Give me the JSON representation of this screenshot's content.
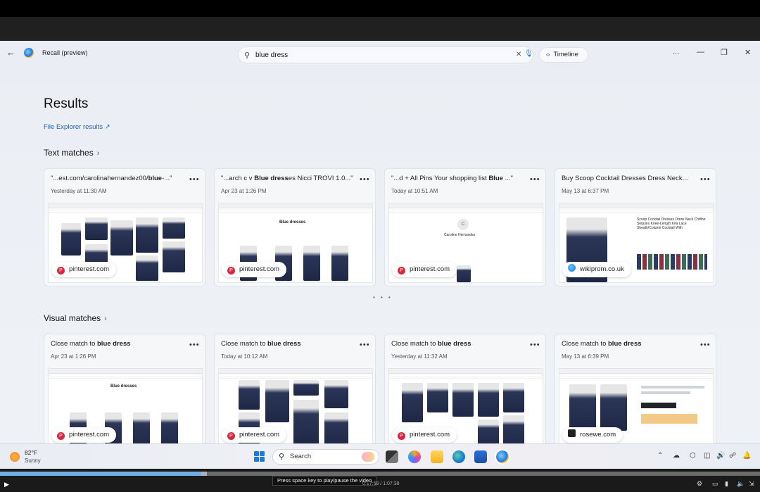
{
  "window": {
    "title": "Recall (preview)",
    "search": {
      "value": "blue dress",
      "placeholder": "Search"
    },
    "timeline_label": "Timeline",
    "more_label": "...",
    "minimize_label": "—",
    "restore_label": "❐",
    "close_label": "✕"
  },
  "main": {
    "heading": "Results",
    "file_explorer_link": "File Explorer results",
    "text_matches": {
      "title": "Text matches",
      "cards": [
        {
          "title_pre": "\"...est.com/carolinahernandez00/",
          "title_bold": "blue",
          "title_post": "-...\"",
          "date": "Yesterday at 11:30 AM",
          "source": "pinterest.com",
          "source_icon": "pinterest-icon"
        },
        {
          "title_pre": "\"...arch c v ",
          "title_bold": "Blue dress",
          "title_post": "es Nicci TROVI 1.0...\"",
          "date": "Apr 23 at 1:26 PM",
          "source": "pinterest.com",
          "source_icon": "pinterest-icon"
        },
        {
          "title_pre": "\"...d + All Pins Your shopping list ",
          "title_bold": "Blue",
          "title_post": " ...\"",
          "date": "Today at 10:51 AM",
          "source": "pinterest.com",
          "source_icon": "pinterest-icon"
        },
        {
          "title_pre": "Buy Scoop Cocktail Dresses Dress Neck...",
          "title_bold": "",
          "title_post": "",
          "date": "May 13 at 6:37 PM",
          "source": "wikiprom.co.uk",
          "source_icon": "wikiprom-icon"
        }
      ]
    },
    "visual_matches": {
      "title": "Visual matches",
      "cards": [
        {
          "title_pre": "Close match to ",
          "title_bold": "blue dress",
          "title_post": "",
          "date": "Apr 23 at 1:26 PM",
          "source": "pinterest.com",
          "source_icon": "pinterest-icon"
        },
        {
          "title_pre": "Close match to ",
          "title_bold": "blue dress",
          "title_post": "",
          "date": "Today at 10:12 AM",
          "source": "pinterest.com",
          "source_icon": "pinterest-icon"
        },
        {
          "title_pre": "Close match to ",
          "title_bold": "blue dress",
          "title_post": "",
          "date": "Yesterday at 11:32 AM",
          "source": "pinterest.com",
          "source_icon": "pinterest-icon"
        },
        {
          "title_pre": "Close match to ",
          "title_bold": "blue dress",
          "title_post": "",
          "date": "May 13 at 6:39 PM",
          "source": "rosewe.com",
          "source_icon": "rosewe-icon"
        }
      ]
    },
    "card_more_label": "•••",
    "pager_dots": "• • •",
    "thumb_texts": {
      "blue_dresses": "Blue dresses",
      "profile_name": "Caroline Hernandez",
      "profile_initial": "C",
      "product_text": "Scoop Cocktail Dresses Dress Neck Chiffon Sequins Knee-Length Kira Lace Sheath/Column Cocktail With"
    }
  },
  "taskbar": {
    "weather_temp": "82°F",
    "weather_condition": "Sunny",
    "search_label": "Search"
  },
  "player": {
    "progress": 0.265,
    "tooltip": "Press space key to play/pause the video",
    "time": "0:17:59 / 1:07:38"
  },
  "colors": {
    "accent": "#1f6fd1",
    "link": "#2063b8",
    "pinterest": "#d7263d",
    "progress": "#6fb1e6"
  }
}
